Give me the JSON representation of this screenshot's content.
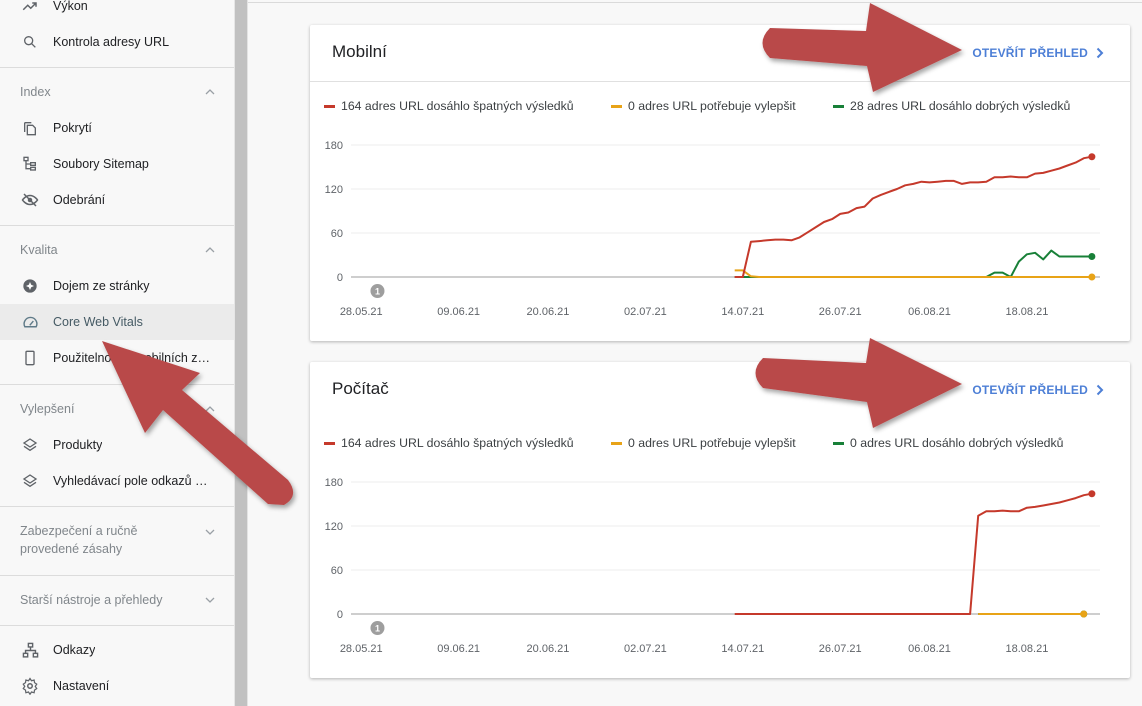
{
  "sidebar": {
    "top_items": [
      {
        "label": "Výkon",
        "icon": "trending-up-icon"
      },
      {
        "label": "Kontrola adresy URL",
        "icon": "search-icon"
      }
    ],
    "sections": [
      {
        "title": "Index",
        "expanded": true,
        "items": [
          {
            "label": "Pokrytí",
            "icon": "copy-pages-icon"
          },
          {
            "label": "Soubory Sitemap",
            "icon": "sitemap-icon"
          },
          {
            "label": "Odebrání",
            "icon": "eye-off-icon"
          }
        ]
      },
      {
        "title": "Kvalita",
        "expanded": true,
        "items": [
          {
            "label": "Dojem ze stránky",
            "icon": "page-experience-icon"
          },
          {
            "label": "Core Web Vitals",
            "icon": "speedometer-icon",
            "active": true
          },
          {
            "label": "Použitelnost v mobilních zař...",
            "icon": "mobile-phone-icon"
          }
        ]
      },
      {
        "title": "Vylepšení",
        "expanded": true,
        "items": [
          {
            "label": "Produkty",
            "icon": "layers-icon"
          },
          {
            "label": "Vyhledávací pole odkazů na ...",
            "icon": "layers-icon"
          }
        ]
      },
      {
        "title_line1": "Zabezpečení a ručně",
        "title_line2": "provedené zásahy",
        "expanded": false
      },
      {
        "title": "Starší nástroje a přehledy",
        "expanded": false
      }
    ],
    "bottom_items": [
      {
        "label": "Odkazy",
        "icon": "links-icon"
      },
      {
        "label": "Nastavení",
        "icon": "gear-icon"
      }
    ]
  },
  "colors": {
    "poor": "#c5392b",
    "needs_improvement": "#e8a317",
    "good": "#188038",
    "link": "#4d7fd6",
    "annotation_arrow": "#b94a4a"
  },
  "cards": [
    {
      "title": "Mobilní",
      "open_report_label": "OTEVŘÍT PŘEHLED",
      "legend": [
        "164 adres URL dosáhlo špatných výsledků",
        "0 adres URL potřebuje vylepšit",
        "28 adres URL dosáhlo dobrých výsledků"
      ]
    },
    {
      "title": "Počítač",
      "open_report_label": "OTEVŘÍT PŘEHLED",
      "legend": [
        "164 adres URL dosáhlo špatných výsledků",
        "0 adres URL potřebuje vylepšit",
        "0 adres URL dosáhlo dobrých výsledků"
      ]
    }
  ],
  "chart_data": [
    {
      "type": "line",
      "title": "Mobilní",
      "x_start": "28.05.21",
      "x_unit": "day",
      "x_ticks": [
        "28.05.21",
        "09.06.21",
        "20.06.21",
        "02.07.21",
        "14.07.21",
        "26.07.21",
        "06.08.21",
        "18.08.21"
      ],
      "x_tick_days": [
        0,
        12,
        23,
        35,
        47,
        59,
        70,
        82
      ],
      "x_range_days": [
        -2,
        91
      ],
      "y_ticks": [
        0,
        60,
        120,
        180
      ],
      "ylim": [
        0,
        180
      ],
      "grid": true,
      "legend_position": "top-left",
      "annotation": {
        "label": "1",
        "day": 2
      },
      "series": [
        {
          "name": "Špatné",
          "color_key": "poor",
          "start_day": 46,
          "values": [
            0,
            0,
            48,
            49,
            50,
            51,
            51,
            50,
            54,
            61,
            68,
            75,
            79,
            86,
            88,
            94,
            96,
            107,
            112,
            116,
            120,
            125,
            127,
            130,
            129,
            130,
            131,
            131,
            127,
            129,
            129,
            130,
            136,
            136,
            137,
            136,
            136,
            141,
            142,
            145,
            148,
            152,
            156,
            162,
            164
          ]
        },
        {
          "name": "Potřebuje vylepšit",
          "color_key": "needs_improvement",
          "start_day": 46,
          "values": [
            9,
            9,
            1,
            0,
            0,
            0,
            0,
            0,
            0,
            0,
            0,
            0,
            0,
            0,
            0,
            0,
            0,
            0,
            0,
            0,
            0,
            0,
            0,
            0,
            0,
            0,
            0,
            0,
            0,
            0,
            0,
            0,
            0,
            0,
            0,
            0,
            0,
            0,
            0,
            0,
            0,
            0,
            0,
            0,
            0
          ]
        },
        {
          "name": "Dobré",
          "color_key": "good",
          "start_day": 46,
          "values": [
            0,
            0,
            0,
            0,
            0,
            0,
            0,
            0,
            0,
            0,
            0,
            0,
            0,
            0,
            0,
            0,
            0,
            0,
            0,
            0,
            0,
            0,
            0,
            0,
            0,
            0,
            0,
            0,
            0,
            0,
            0,
            0,
            6,
            6,
            0,
            21,
            31,
            33,
            24,
            36,
            28,
            28,
            28,
            28,
            28
          ]
        }
      ]
    },
    {
      "type": "line",
      "title": "Počítač",
      "x_start": "28.05.21",
      "x_unit": "day",
      "x_ticks": [
        "28.05.21",
        "09.06.21",
        "20.06.21",
        "02.07.21",
        "14.07.21",
        "26.07.21",
        "06.08.21",
        "18.08.21"
      ],
      "x_tick_days": [
        0,
        12,
        23,
        35,
        47,
        59,
        70,
        82
      ],
      "x_range_days": [
        -2,
        91
      ],
      "y_ticks": [
        0,
        60,
        120,
        180
      ],
      "ylim": [
        0,
        180
      ],
      "grid": true,
      "legend_position": "top-left",
      "annotation": {
        "label": "1",
        "day": 2
      },
      "series": [
        {
          "name": "Špatné",
          "color_key": "poor",
          "start_day": 46,
          "values": [
            0,
            0,
            0,
            0,
            0,
            0,
            0,
            0,
            0,
            0,
            0,
            0,
            0,
            0,
            0,
            0,
            0,
            0,
            0,
            0,
            0,
            0,
            0,
            0,
            0,
            0,
            0,
            0,
            0,
            0,
            134,
            140,
            140,
            141,
            140,
            140,
            145,
            146,
            148,
            150,
            152,
            155,
            158,
            162,
            164
          ]
        },
        {
          "name": "Potřebuje vylepšit",
          "color_key": "needs_improvement",
          "start_day": 76,
          "values": [
            0,
            0,
            0,
            0,
            0,
            0,
            0,
            0,
            0,
            0,
            0,
            0,
            0,
            0
          ]
        },
        {
          "name": "Dobré",
          "color_key": "good",
          "start_day": 76,
          "values": [
            0,
            0,
            0,
            0,
            0,
            0,
            0,
            0,
            0,
            0,
            0,
            0,
            0,
            0
          ]
        }
      ]
    }
  ]
}
